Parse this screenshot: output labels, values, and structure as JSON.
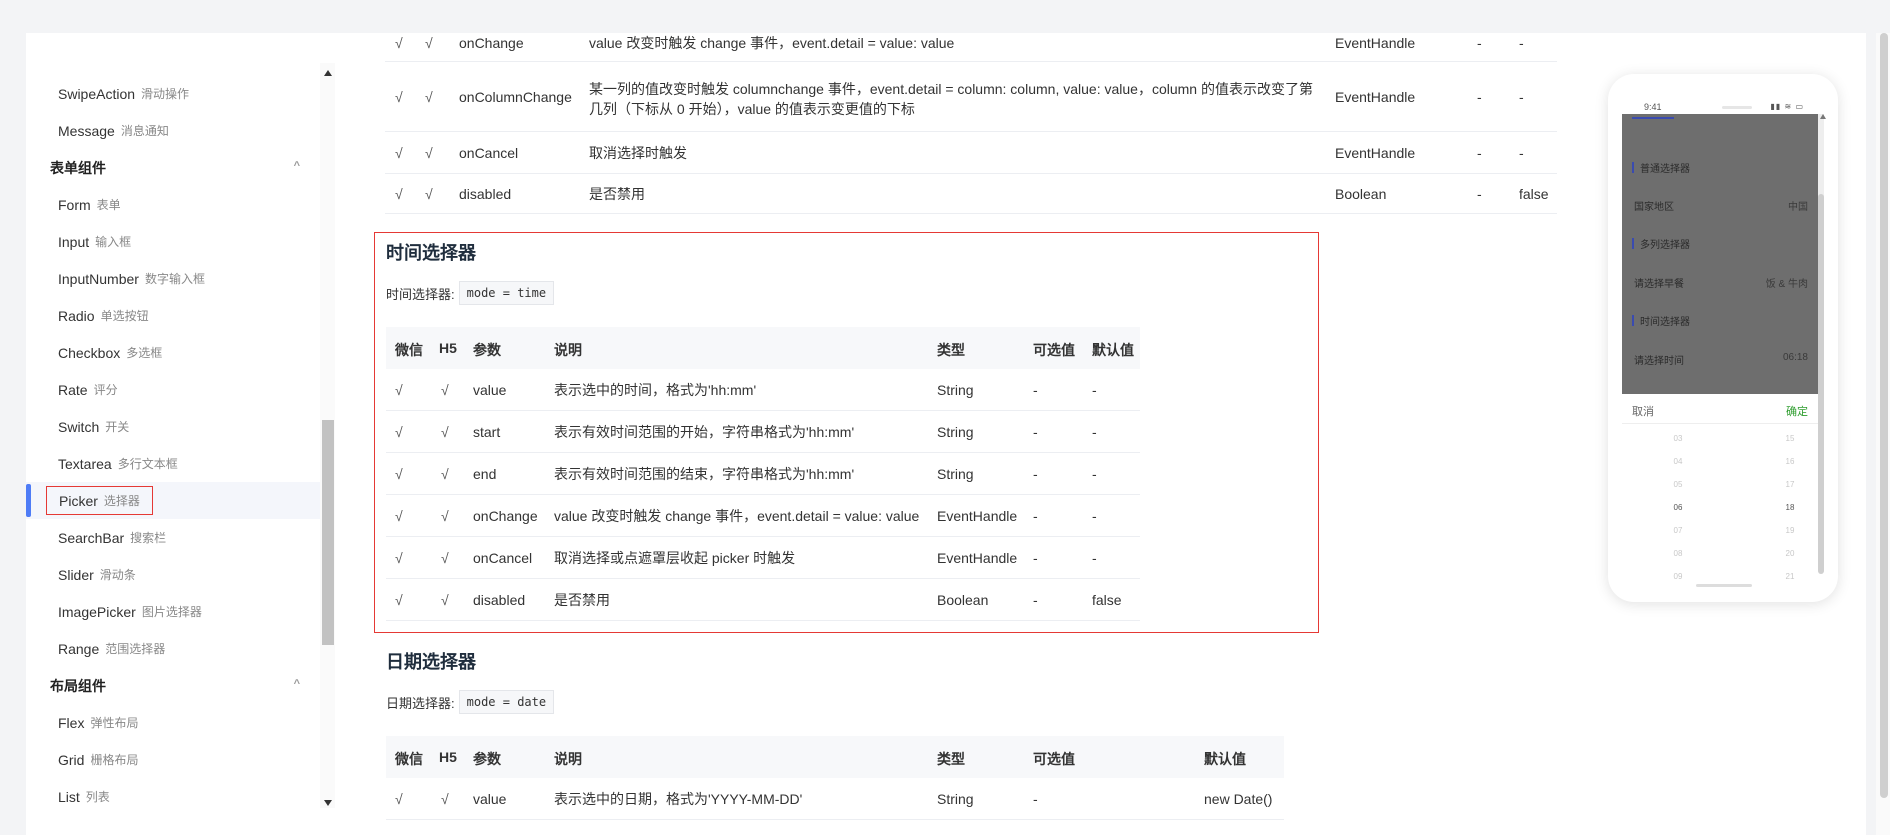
{
  "sidebar": {
    "items": [
      {
        "label": "SwipeAction",
        "sub": "滑动操作"
      },
      {
        "label": "Message",
        "sub": "消息通知"
      },
      {
        "group": "表单组件"
      },
      {
        "label": "Form",
        "sub": "表单"
      },
      {
        "label": "Input",
        "sub": "输入框"
      },
      {
        "label": "InputNumber",
        "sub": "数字输入框"
      },
      {
        "label": "Radio",
        "sub": "单选按钮"
      },
      {
        "label": "Checkbox",
        "sub": "多选框"
      },
      {
        "label": "Rate",
        "sub": "评分"
      },
      {
        "label": "Switch",
        "sub": "开关"
      },
      {
        "label": "Textarea",
        "sub": "多行文本框"
      },
      {
        "label": "Picker",
        "sub": "选择器"
      },
      {
        "label": "SearchBar",
        "sub": "搜索栏"
      },
      {
        "label": "Slider",
        "sub": "滑动条"
      },
      {
        "label": "ImagePicker",
        "sub": "图片选择器"
      },
      {
        "label": "Range",
        "sub": "范围选择器"
      },
      {
        "group": "布局组件"
      },
      {
        "label": "Flex",
        "sub": "弹性布局"
      },
      {
        "label": "Grid",
        "sub": "栅格布局"
      },
      {
        "label": "List",
        "sub": "列表"
      }
    ],
    "chevron": "^"
  },
  "prev_table": {
    "rows": [
      {
        "wx": "√",
        "h5": "√",
        "param": "onChange",
        "desc": "value 改变时触发 change 事件，event.detail = value: value",
        "type": "EventHandle",
        "opt": "-",
        "def": "-"
      },
      {
        "wx": "√",
        "h5": "√",
        "param": "onColumnChange",
        "desc1": "某一列的值改变时触发 columnchange 事件，event.detail = column: column, value: value，column 的值表示改变了第",
        "desc2": "几列（下标从 0 开始），value 的值表示变更值的下标",
        "type": "EventHandle",
        "opt": "-",
        "def": "-"
      },
      {
        "wx": "√",
        "h5": "√",
        "param": "onCancel",
        "desc": "取消选择时触发",
        "type": "EventHandle",
        "opt": "-",
        "def": "-"
      },
      {
        "wx": "√",
        "h5": "√",
        "param": "disabled",
        "desc": "是否禁用",
        "type": "Boolean",
        "opt": "-",
        "def": "false"
      }
    ]
  },
  "time_section": {
    "title": "时间选择器",
    "mode_label": "时间选择器:",
    "mode_code": "mode = time",
    "headers": {
      "wx": "微信",
      "h5": "H5",
      "param": "参数",
      "desc": "说明",
      "type": "类型",
      "opt": "可选值",
      "def": "默认值"
    },
    "rows": [
      {
        "wx": "√",
        "h5": "√",
        "param": "value",
        "desc": "表示选中的时间，格式为'hh:mm'",
        "type": "String",
        "opt": "-",
        "def": "-"
      },
      {
        "wx": "√",
        "h5": "√",
        "param": "start",
        "desc": "表示有效时间范围的开始，字符串格式为'hh:mm'",
        "type": "String",
        "opt": "-",
        "def": "-"
      },
      {
        "wx": "√",
        "h5": "√",
        "param": "end",
        "desc": "表示有效时间范围的结束，字符串格式为'hh:mm'",
        "type": "String",
        "opt": "-",
        "def": "-"
      },
      {
        "wx": "√",
        "h5": "√",
        "param": "onChange",
        "desc": "value 改变时触发 change 事件，event.detail = value: value",
        "type": "EventHandle",
        "opt": "-",
        "def": "-"
      },
      {
        "wx": "√",
        "h5": "√",
        "param": "onCancel",
        "desc": "取消选择或点遮罩层收起 picker 时触发",
        "type": "EventHandle",
        "opt": "-",
        "def": "-"
      },
      {
        "wx": "√",
        "h5": "√",
        "param": "disabled",
        "desc": "是否禁用",
        "type": "Boolean",
        "opt": "-",
        "def": "false"
      }
    ]
  },
  "date_section": {
    "title": "日期选择器",
    "mode_label": "日期选择器:",
    "mode_code": "mode = date",
    "headers": {
      "wx": "微信",
      "h5": "H5",
      "param": "参数",
      "desc": "说明",
      "type": "类型",
      "opt": "可选值",
      "def": "默认值"
    },
    "rows": [
      {
        "wx": "√",
        "h5": "√",
        "param": "value",
        "desc": "表示选中的日期，格式为'YYYY-MM-DD'",
        "type": "String",
        "opt": "-",
        "def": "new Date()"
      }
    ]
  },
  "phone": {
    "time": "9:41",
    "status_icons": "▮▮ ≋ ▭",
    "sections": [
      {
        "header": "普通选择器"
      },
      {
        "label": "国家地区",
        "value": "中国"
      },
      {
        "header": "多列选择器"
      },
      {
        "label": "请选择早餐",
        "value": "饭 & 牛肉"
      },
      {
        "header": "时间选择器"
      },
      {
        "label": "请选择时间",
        "value": "06:18"
      }
    ],
    "cancel": "取消",
    "confirm": "确定",
    "hours": [
      "03",
      "04",
      "05",
      "06",
      "07",
      "08",
      "09"
    ],
    "minutes": [
      "15",
      "16",
      "17",
      "18",
      "19",
      "20",
      "21"
    ]
  }
}
